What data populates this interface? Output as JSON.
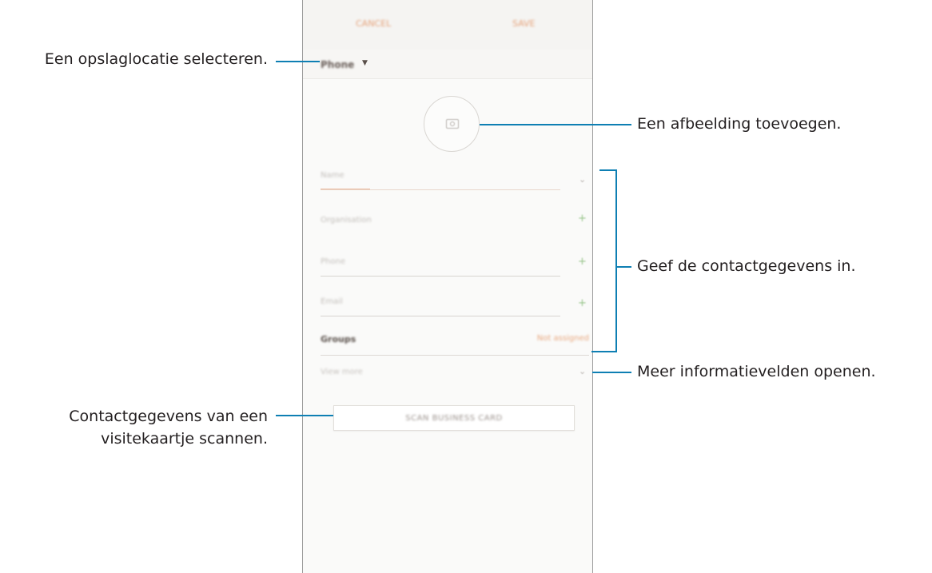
{
  "phone": {
    "topbar": {
      "cancel_label": "CANCEL",
      "save_label": "SAVE"
    },
    "storage": {
      "label": "Phone"
    },
    "fields": {
      "name_placeholder": "Name",
      "organisation_placeholder": "Organisation",
      "phone_placeholder": "Phone",
      "email_placeholder": "Email"
    },
    "groups": {
      "label": "Groups",
      "value": "Not assigned"
    },
    "view_more": "View more",
    "scan_button": "SCAN BUSINESS CARD"
  },
  "callouts": {
    "storage": "Een opslaglocatie selecteren.",
    "image": "Een afbeelding toevoegen.",
    "contact": "Geef de contactgegevens in.",
    "more": "Meer informatievelden openen.",
    "scan_line1": "Contactgegevens van een",
    "scan_line2": "visitekaartje scannen."
  },
  "colors": {
    "accent": "#0e7fb3",
    "app_accent": "#e6a27a"
  },
  "icons": {
    "storage": "caret-down-icon",
    "photo": "camera-icon",
    "expand": "chevron-down-icon",
    "add": "plus-icon"
  }
}
